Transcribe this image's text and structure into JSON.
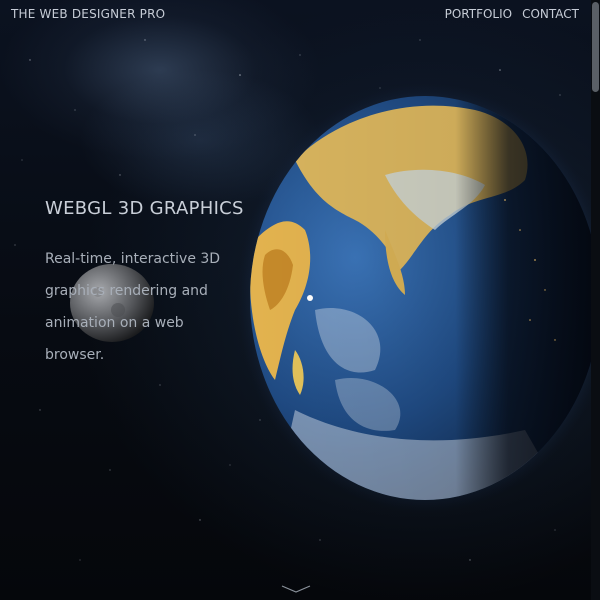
{
  "header": {
    "brand": "THE WEB DESIGNER PRO",
    "nav": [
      {
        "label": "PORTFOLIO"
      },
      {
        "label": "CONTACT"
      }
    ]
  },
  "hero": {
    "title": "WEBGL 3D GRAPHICS",
    "description": "Real-time, interactive 3D graphics rendering and animation on a web browser."
  },
  "icons": {
    "scroll_down": "chevron-down-icon"
  },
  "colors": {
    "background": "#05080d",
    "text": "#c6ccd6",
    "ocean": "#1f4a82",
    "land": "#d9b25a"
  }
}
